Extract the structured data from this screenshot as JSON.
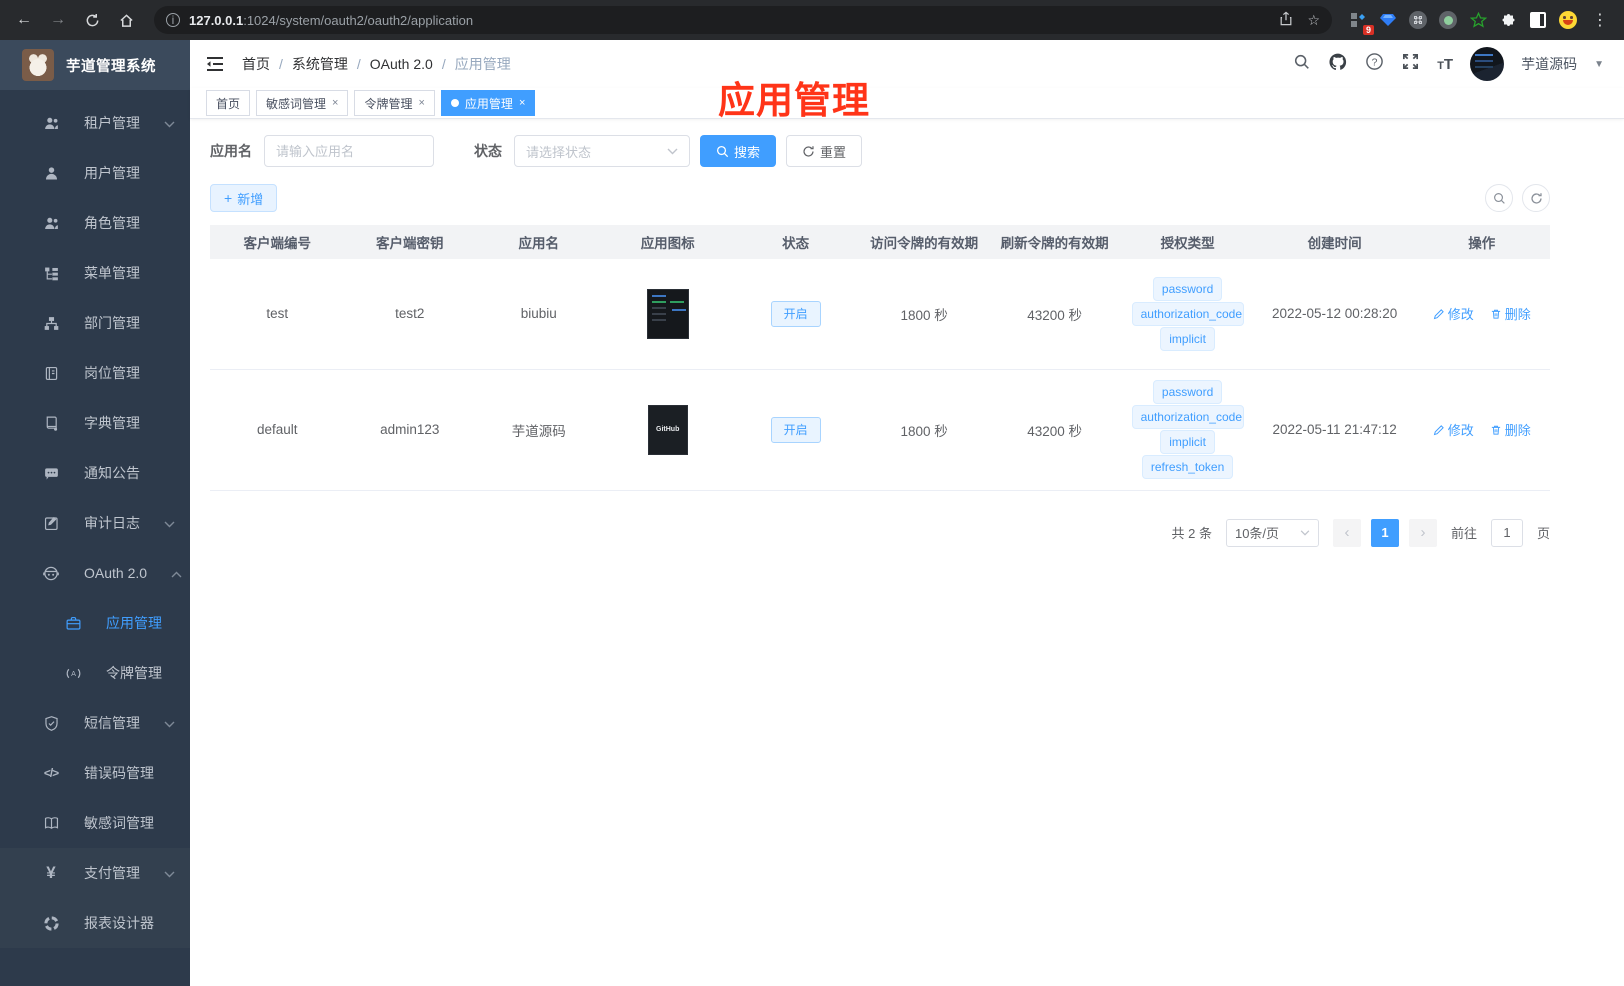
{
  "colors": {
    "accent": "#409eff",
    "annotation_red": "#ff3418",
    "sidebar_bg": "#2d3a4b",
    "tag_bg": "#ecf5ff",
    "chrome_bg": "#282a2d"
  },
  "browser": {
    "url_host": "127.0.0.1",
    "url_rest": ":1024/system/oauth2/oauth2/application",
    "extension_badge": "9"
  },
  "sidebar": {
    "title": "芋道管理系统",
    "items": [
      {
        "label": "租户管理"
      },
      {
        "label": "用户管理"
      },
      {
        "label": "角色管理"
      },
      {
        "label": "菜单管理"
      },
      {
        "label": "部门管理"
      },
      {
        "label": "岗位管理"
      },
      {
        "label": "字典管理"
      },
      {
        "label": "通知公告"
      },
      {
        "label": "审计日志"
      },
      {
        "label": "OAuth 2.0"
      },
      {
        "label": "应用管理"
      },
      {
        "label": "令牌管理"
      },
      {
        "label": "短信管理"
      },
      {
        "label": "错误码管理"
      },
      {
        "label": "敏感词管理"
      },
      {
        "label": "支付管理"
      },
      {
        "label": "报表设计器"
      }
    ]
  },
  "header": {
    "breadcrumb": [
      "首页",
      "系统管理",
      "OAuth 2.0",
      "应用管理"
    ],
    "username": "芋道源码"
  },
  "annotation": {
    "title": "应用管理"
  },
  "tabs": [
    {
      "label": "首页"
    },
    {
      "label": "敏感词管理"
    },
    {
      "label": "令牌管理"
    },
    {
      "label": "应用管理"
    }
  ],
  "filters": {
    "name_label": "应用名",
    "name_placeholder": "请输入应用名",
    "status_label": "状态",
    "status_placeholder": "请选择状态",
    "search_label": "搜索",
    "reset_label": "重置"
  },
  "toolbar": {
    "add_label": "新增"
  },
  "table": {
    "headers": [
      "客户端编号",
      "客户端密钥",
      "应用名",
      "应用图标",
      "状态",
      "访问令牌的有效期",
      "刷新令牌的有效期",
      "授权类型",
      "创建时间",
      "操作"
    ],
    "rows": [
      {
        "client_id": "test",
        "client_secret": "test2",
        "app_name": "biubiu",
        "status": "开启",
        "access_token_ttl": "1800 秒",
        "refresh_token_ttl": "43200 秒",
        "grant_types": [
          "password",
          "authorization_code",
          "implicit"
        ],
        "created_at": "2022-05-12 00:28:20"
      },
      {
        "client_id": "default",
        "client_secret": "admin123",
        "app_name": "芋道源码",
        "icon_text": "GitHub",
        "status": "开启",
        "access_token_ttl": "1800 秒",
        "refresh_token_ttl": "43200 秒",
        "grant_types": [
          "password",
          "authorization_code",
          "implicit",
          "refresh_token"
        ],
        "created_at": "2022-05-11 21:47:12"
      }
    ],
    "row_actions": {
      "edit": "修改",
      "delete": "删除"
    }
  },
  "pagination": {
    "total": "共 2 条",
    "page_size": "10条/页",
    "page": "1",
    "goto_label": "前往",
    "goto_value": "1",
    "unit_label": "页"
  }
}
